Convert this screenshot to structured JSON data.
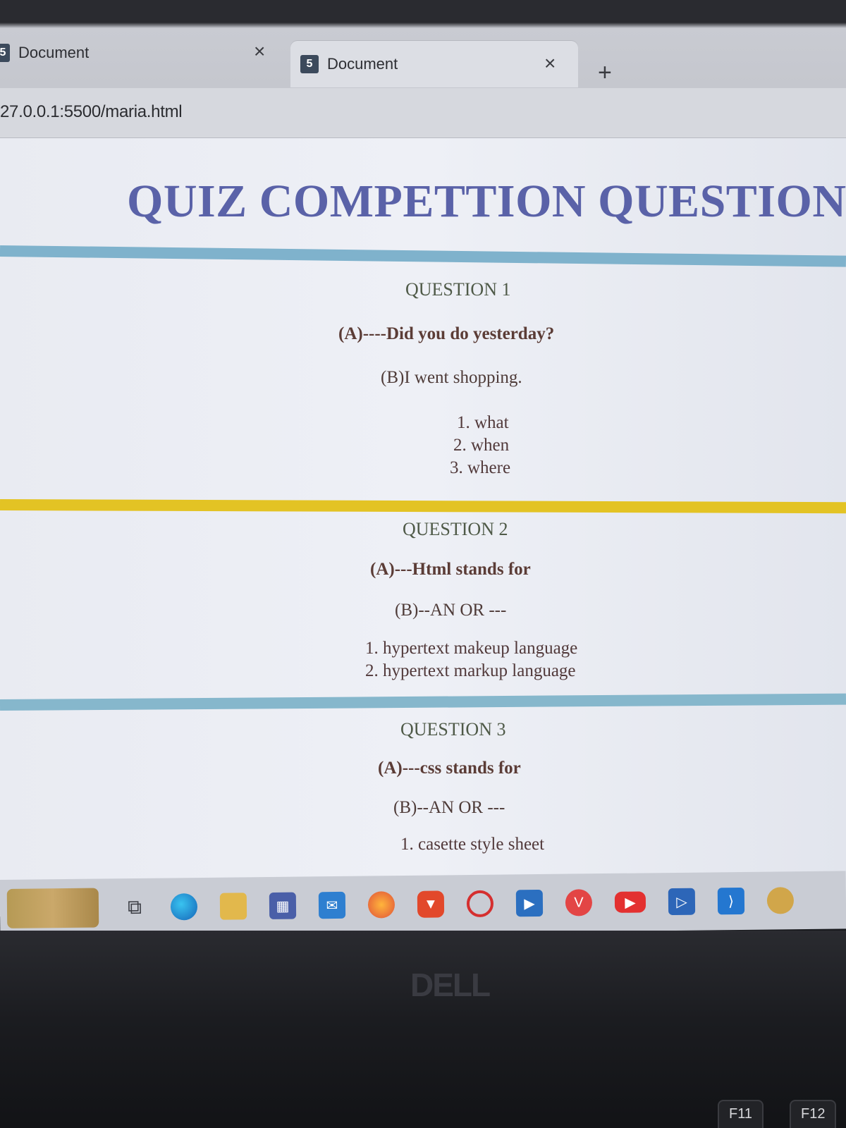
{
  "browser": {
    "tabs": [
      {
        "title": "Document",
        "favicon": "document-favicon",
        "close_label": "×"
      },
      {
        "title": "Document",
        "favicon": "document-favicon",
        "close_label": "×"
      }
    ],
    "new_tab_label": "+",
    "url": "27.0.0.1:5500/maria.html"
  },
  "page": {
    "title": "QUIZ COMPETTION QUESTIONS",
    "questions": [
      {
        "heading": "QUESTION 1",
        "a": "(A)----Did you do yesterday?",
        "b": "(B)I went shopping.",
        "options": [
          "1. what",
          "2. when",
          "3. where"
        ]
      },
      {
        "heading": "QUESTION 2",
        "a": "(A)---Html stands for",
        "b": "(B)--AN OR ---",
        "options": [
          "1. hypertext makeup language",
          "2. hypertext markup language"
        ]
      },
      {
        "heading": "QUESTION 3",
        "a": "(A)---css stands for",
        "b": "(B)--AN OR ---",
        "options": [
          "1. casette style sheet"
        ]
      }
    ],
    "colors": {
      "title": "#5a62a8",
      "divider_blue": "#7fb2cc",
      "divider_yellow": "#e3c324",
      "text": "#5b3c36"
    }
  },
  "taskbar": {
    "items": [
      "weather-widget",
      "task-view-icon",
      "edge-icon",
      "file-explorer-icon",
      "store-icon",
      "mail-icon",
      "firefox-icon",
      "brave-icon",
      "opera-icon",
      "media-player-icon",
      "vivaldi-icon",
      "youtube-icon",
      "remote-desktop-icon",
      "vscode-icon",
      "app-icon"
    ]
  },
  "laptop": {
    "brand": "DELL",
    "keys": [
      "F11",
      "F12"
    ]
  }
}
